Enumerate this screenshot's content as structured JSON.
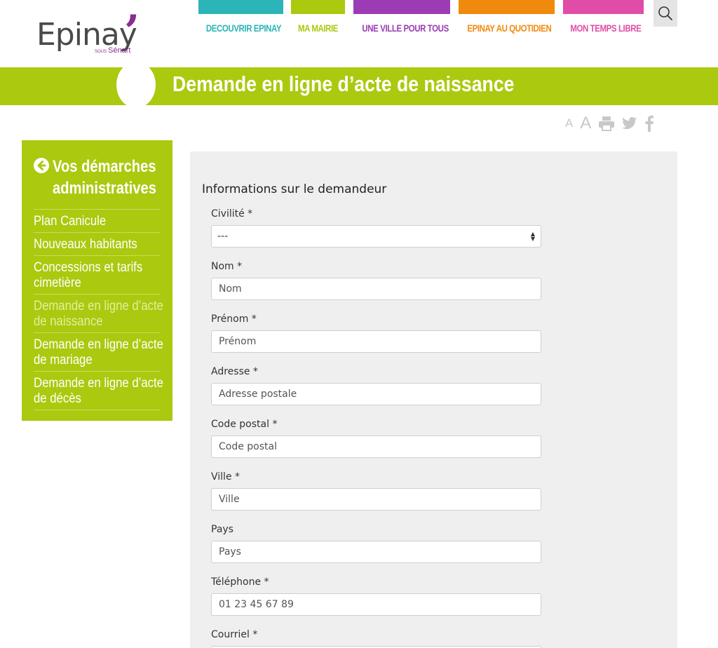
{
  "logo": {
    "name": "Epinay",
    "sub_small": "SOUS",
    "sub": "Sénart"
  },
  "nav": {
    "items": [
      {
        "label": "DECOUVRIR EPINAY",
        "color": "#2bb5b8"
      },
      {
        "label": "MA MAIRIE",
        "color": "#abc90f"
      },
      {
        "label": "UNE VILLE POUR TOUS",
        "color": "#9b3cb5"
      },
      {
        "label": "EPINAY AU QUOTIDIEN",
        "color": "#f08a0c"
      },
      {
        "label": "MON TEMPS LIBRE",
        "color": "#e04da7"
      }
    ],
    "search_icon": "search-icon"
  },
  "page": {
    "title": "Demande en ligne d’acte de naissance"
  },
  "tools": {
    "font_small": "A",
    "font_large": "A",
    "icons": [
      "print-icon",
      "twitter-icon",
      "facebook-icon"
    ]
  },
  "sidebar": {
    "title_line1": "Vos démarches",
    "title_line2": "administratives",
    "items": [
      {
        "label": "Plan Canicule"
      },
      {
        "label": "Nouveaux habitants"
      },
      {
        "label": "Concessions et tarifs cimetière"
      },
      {
        "label": "Demande en ligne d’acte de naissance",
        "active": true
      },
      {
        "label": "Demande en ligne d’acte de mariage"
      },
      {
        "label": "Demande en ligne d’acte de décès"
      }
    ]
  },
  "form": {
    "section_title": "Informations sur le demandeur",
    "civilite": {
      "label": "Civilité *",
      "value": "---"
    },
    "nom": {
      "label": "Nom *",
      "placeholder": "Nom"
    },
    "prenom": {
      "label": "Prénom *",
      "placeholder": "Prénom"
    },
    "adresse": {
      "label": "Adresse *",
      "placeholder": "Adresse postale"
    },
    "code_postal": {
      "label": "Code postal *",
      "placeholder": "Code postal"
    },
    "ville": {
      "label": "Ville *",
      "placeholder": "Ville"
    },
    "pays": {
      "label": "Pays",
      "placeholder": "Pays"
    },
    "telephone": {
      "label": "Téléphone *",
      "placeholder": "01 23 45 67 89"
    },
    "courriel": {
      "label": "Courriel *"
    }
  },
  "colors": {
    "green": "#abc90f",
    "logo_purple": "#8a2d91",
    "panel_bg": "#efefef"
  }
}
